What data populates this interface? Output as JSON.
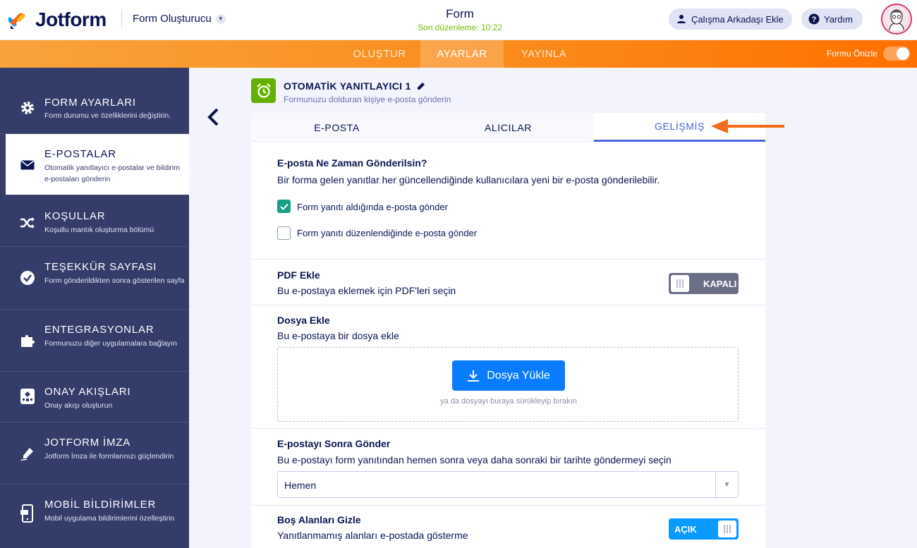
{
  "header": {
    "logo_text": "Jotform",
    "builder_label": "Form Oluşturucu",
    "form_title": "Form",
    "last_edited": "Son düzenleme: 10:22",
    "add_collaborator": "Çalışma Arkadaşı Ekle",
    "help": "Yardım"
  },
  "nav": {
    "tabs": [
      "OLUŞTUR",
      "AYARLAR",
      "YAYINLA"
    ],
    "active": "AYARLAR",
    "preview_label": "Formu Önizle"
  },
  "sidebar": {
    "items": [
      {
        "title": "FORM AYARLARI",
        "desc": "Form durumu ve özelliklerini değiştirin.",
        "icon": "gear-icon"
      },
      {
        "title": "E-POSTALAR",
        "desc": "Otomatik yanıtlayıcı e-postalar ve bildirim e-postaları gönderin",
        "icon": "envelope-icon"
      },
      {
        "title": "KOŞULLAR",
        "desc": "Koşullu mantık oluşturma bölümü",
        "icon": "shuffle-icon"
      },
      {
        "title": "TEŞEKKÜR SAYFASI",
        "desc": "Form gönderildikten sonra gösterilen sayfa",
        "icon": "check-circle-icon"
      },
      {
        "title": "ENTEGRASYONLAR",
        "desc": "Formunuzu diğer uygulamalara bağlayın",
        "icon": "puzzle-icon"
      },
      {
        "title": "ONAY AKIŞLARI",
        "desc": "Onay akışı oluşturun",
        "icon": "flow-icon"
      },
      {
        "title": "JOTFORM İMZA",
        "desc": "Jotform İmza ile formlarınızı güçlendirin",
        "icon": "pen-icon"
      },
      {
        "title": "MOBİL BİLDİRİMLER",
        "desc": "Mobil uygulama bildirimlerini özelleştirin",
        "icon": "phone-icon"
      }
    ],
    "active_index": 1
  },
  "autoresponder": {
    "title": "OTOMATİK YANITLAYICI 1",
    "subtitle": "Formunuzu dolduran kişiye e-posta gönderin"
  },
  "tabs": [
    "E-POSTA",
    "ALICILAR",
    "GELİŞMİŞ"
  ],
  "active_tab": "GELİŞMİŞ",
  "when_send": {
    "title": "E-posta Ne Zaman Gönderilsin?",
    "desc": "Bir forma gelen yanıtlar her güncellendiğinde kullanıcılara yeni bir e-posta gönderilebilir.",
    "options": [
      {
        "label": "Form yanıtı aldığında e-posta gönder",
        "checked": true
      },
      {
        "label": "Form yanıtı düzenlendiğinde e-posta gönder",
        "checked": false
      }
    ]
  },
  "pdf": {
    "title": "PDF Ekle",
    "desc": "Bu e-postaya eklemek için PDF'leri seçin",
    "state": "KAPALI"
  },
  "file": {
    "title": "Dosya Ekle",
    "desc": "Bu e-postaya bir dosya ekle",
    "upload_label": "Dosya Yükle",
    "hint": "ya da dosyayı buraya sürükleyip bırakın"
  },
  "later": {
    "title": "E-postayı Sonra Gönder",
    "desc": "Bu e-postayı form yanıtından hemen sonra veya daha sonraki bir tarihte göndermeyi seçin",
    "selected": "Hemen"
  },
  "hide_empty": {
    "title": "Boş Alanları Gizle",
    "desc": "Yanıtlanmamış alanları e-postada gösterme",
    "state": "AÇIK"
  },
  "colors": {
    "orange": "#ff7000",
    "accent": "#4c63de",
    "sidebar": "#343c6a",
    "green": "#64b200",
    "blue": "#0a7cff"
  }
}
